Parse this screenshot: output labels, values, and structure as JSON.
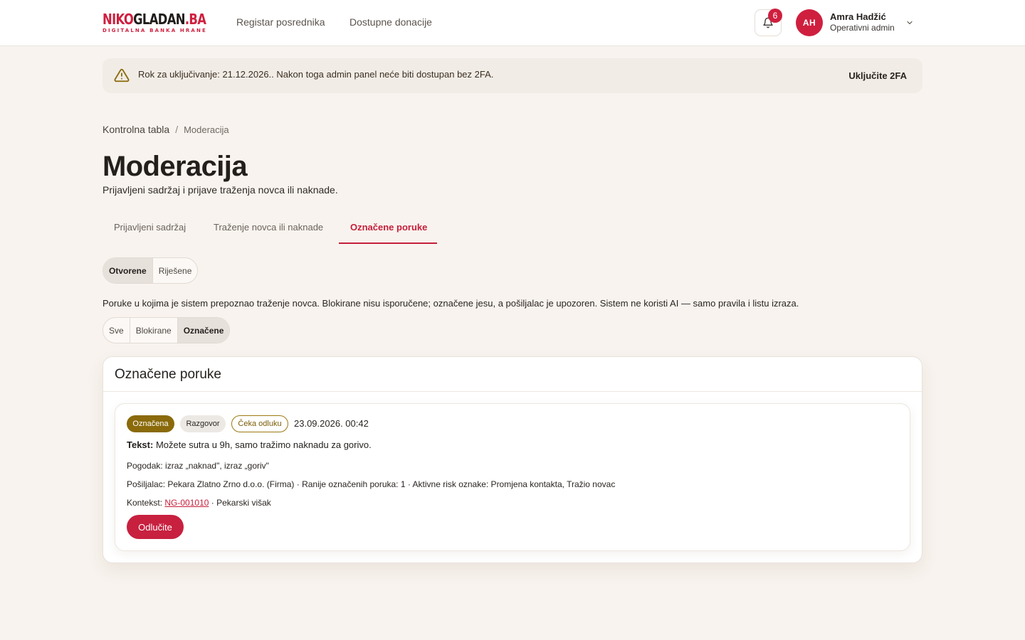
{
  "header": {
    "logo_main_a": "NIKO",
    "logo_main_b": "GLADAN",
    "logo_main_c": ".BA",
    "logo_sub": "DIGITALNA BANKA HRANE",
    "nav": [
      "Registar posrednika",
      "Dostupne donacije"
    ],
    "notifications_count": "6",
    "user": {
      "initials": "AH",
      "name": "Amra Hadžić",
      "role": "Operativni admin"
    }
  },
  "banner": {
    "text": "Rok za uključivanje: 21.12.2026.. Nakon toga admin panel neće biti dostupan bez 2FA.",
    "action": "Uključite 2FA"
  },
  "breadcrumb": {
    "parent": "Kontrolna tabla",
    "separator": "/",
    "current": "Moderacija"
  },
  "page": {
    "title": "Moderacija",
    "subtitle": "Prijavljeni sadržaj i prijave traženja novca ili naknade."
  },
  "tabs": [
    {
      "label": "Prijavljeni sadržaj",
      "active": false
    },
    {
      "label": "Traženje novca ili naknade",
      "active": false
    },
    {
      "label": "Označene poruke",
      "active": true
    }
  ],
  "status_filter": {
    "options": [
      "Otvorene",
      "Riješene"
    ],
    "selected": "Otvorene"
  },
  "description": "Poruke u kojima je sistem prepoznao traženje novca. Blokirane nisu isporučene; označene jesu, a pošiljalac je upozoren. Sistem ne koristi AI — samo pravila i listu izraza.",
  "type_filter": {
    "options": [
      "Sve",
      "Blokirane",
      "Označene"
    ],
    "selected": "Označene"
  },
  "card": {
    "title": "Označene poruke",
    "message": {
      "badges": {
        "status": "Označena",
        "type": "Razgovor",
        "decision": "Čeka odluku"
      },
      "date": "23.09.2026. 00:42",
      "text_label": "Tekst:",
      "text": "Možete sutra u 9h, samo tražimo naknadu za gorivo.",
      "match": "Pogodak: izraz „naknad\", izraz „goriv\"",
      "sender": "Pošiljalac: Pekara Zlatno Zrno d.o.o. (Firma) · Ranije označenih poruka: 1 · Aktivne risk oznake: Promjena kontakta, Tražio novac",
      "context_label": "Kontekst:",
      "context_id": "NG-001010",
      "context_rest": "· Pekarski višak",
      "decide_label": "Odlučite"
    }
  },
  "colors": {
    "brand": "#cf1f3f",
    "flag": "#8a6a0b",
    "background": "#f8f3ee"
  },
  "icons": [
    "bell-icon",
    "warning-triangle-icon",
    "chevron-down-icon"
  ]
}
